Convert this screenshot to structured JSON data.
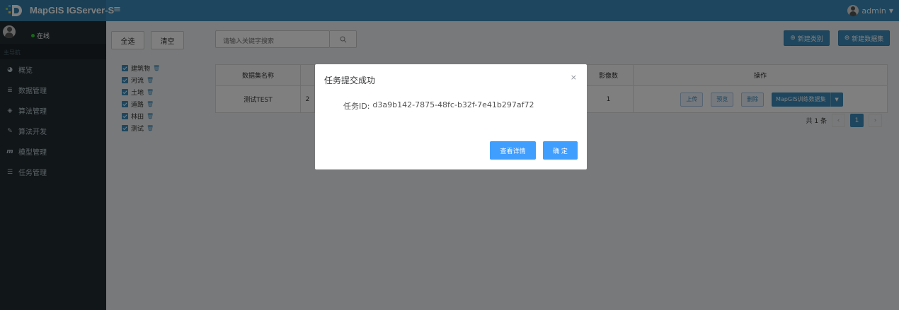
{
  "header": {
    "app_title": "MapGIS IGServer-S",
    "menu_toggle": "≡",
    "user_name": "admin"
  },
  "sidebar": {
    "status_text": "在线",
    "section_label": "主导航",
    "items": [
      {
        "label": "概览",
        "icon": "chart-pie-icon"
      },
      {
        "label": "数据管理",
        "icon": "database-icon"
      },
      {
        "label": "算法管理",
        "icon": "cube-icon"
      },
      {
        "label": "算法开发",
        "icon": "edit-icon"
      },
      {
        "label": "模型管理",
        "icon": "model-icon"
      },
      {
        "label": "任务管理",
        "icon": "list-icon"
      }
    ]
  },
  "toolbar": {
    "select_all": "全选",
    "clear": "清空",
    "search_placeholder": "请输入关键字搜索",
    "new_category": "新建类别",
    "new_dataset": "新建数据集"
  },
  "categories": [
    {
      "label": "建筑物"
    },
    {
      "label": "河流"
    },
    {
      "label": "土地"
    },
    {
      "label": "道路"
    },
    {
      "label": "林田"
    },
    {
      "label": "测试"
    }
  ],
  "table": {
    "headers": {
      "name": "数据集名称",
      "count": "影像数",
      "actions": "操作"
    },
    "row": {
      "name": "测试TEST",
      "partial": "2",
      "count": "1",
      "upload": "上传",
      "preview": "预览",
      "delete": "删除",
      "train": "MapGIS训练数据集"
    }
  },
  "pagination": {
    "total": "共 1 条",
    "prev": "‹",
    "current": "1",
    "next": "›"
  },
  "dialog": {
    "title": "任务提交成功",
    "close": "×",
    "id_label": "任务ID:",
    "id_value": "d3a9b142-7875-48fc-b32f-7e41b297af72",
    "details_button": "查看详情",
    "confirm_button": "确 定"
  },
  "colors": {
    "header_bg": "#3c8dbc",
    "sidebar_bg": "#222d32",
    "accent": "#409eff"
  }
}
